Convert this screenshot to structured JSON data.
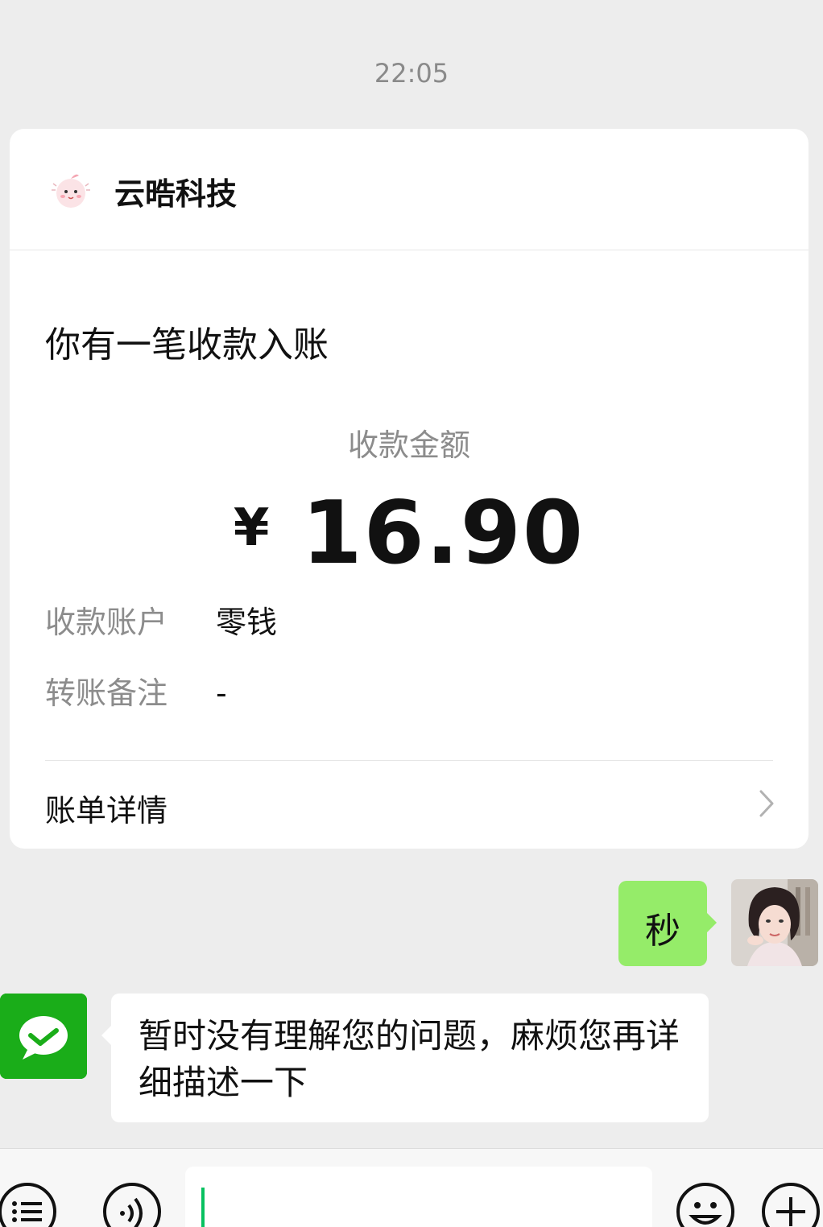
{
  "chat": {
    "timestamp": "22:05",
    "payment_card": {
      "sender_name": "云晧科技",
      "notice_title": "你有一笔收款入账",
      "amount_label": "收款金额",
      "currency_symbol": "¥",
      "amount": "16.90",
      "account_label": "收款账户",
      "account_value": "零钱",
      "remark_label": "转账备注",
      "remark_value": "-",
      "bill_details_label": "账单详情"
    },
    "outgoing_message": {
      "text": "秒"
    },
    "incoming_message": {
      "text": "暂时没有理解您的问题，麻烦您再详细描述一下"
    }
  },
  "input_bar": {
    "value": ""
  },
  "colors": {
    "background": "#ededed",
    "outgoing_bubble": "#95ec69",
    "bot_avatar": "#1aad19",
    "caret": "#07c160"
  },
  "icons": {
    "sender_avatar": "peach-mascot-icon",
    "chevron": "chevron-right-icon",
    "menu": "list-menu-icon",
    "voice": "voice-icon",
    "emoji": "emoji-icon",
    "plus": "plus-icon"
  }
}
